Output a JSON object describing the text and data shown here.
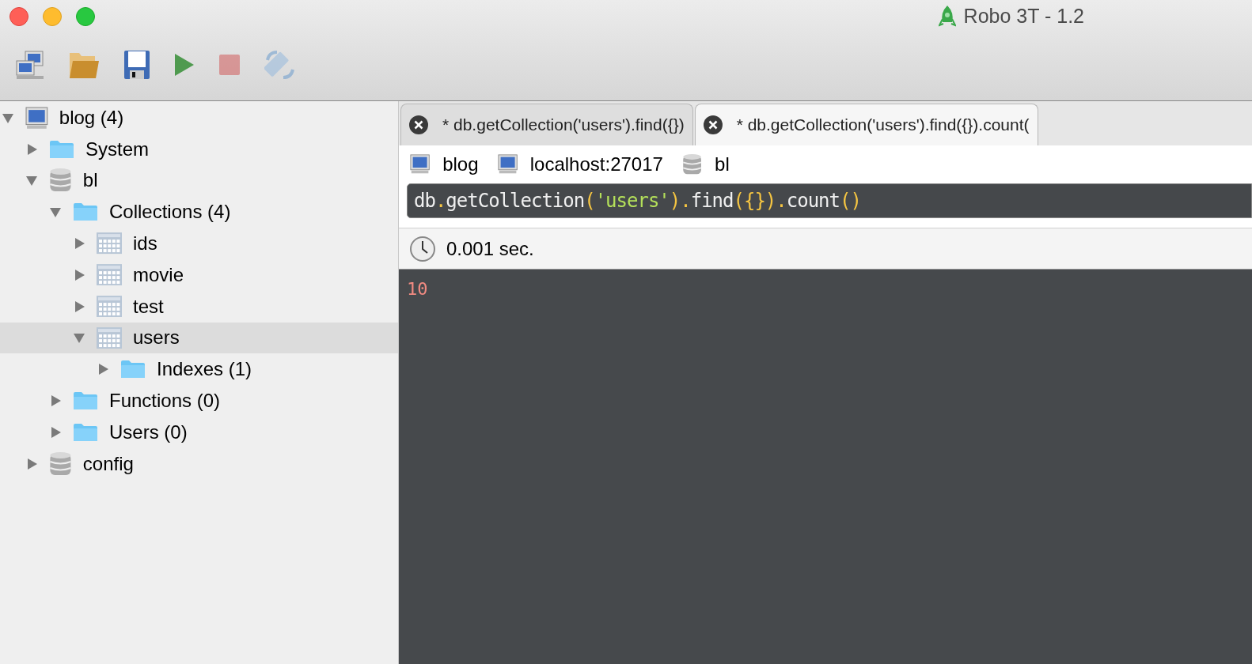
{
  "window": {
    "title": "Robo 3T - 1.2"
  },
  "toolbar": [
    {
      "kind": "connect",
      "disabled": false
    },
    {
      "kind": "open",
      "disabled": false
    },
    {
      "kind": "save",
      "disabled": false
    },
    {
      "kind": "run",
      "disabled": false
    },
    {
      "kind": "stop",
      "disabled": true
    },
    {
      "kind": "rotate",
      "disabled": true
    }
  ],
  "tree": [
    {
      "label": "blog (4)",
      "kind": "server",
      "expanded": true,
      "selected": false,
      "children": [
        {
          "label": "System",
          "kind": "folder",
          "expanded": false,
          "selected": false
        },
        {
          "label": "bl",
          "kind": "database",
          "expanded": true,
          "selected": false,
          "children": [
            {
              "label": "Collections (4)",
              "kind": "folder",
              "expanded": true,
              "selected": false,
              "children": [
                {
                  "label": "ids",
                  "kind": "collection",
                  "expanded": false,
                  "selected": false
                },
                {
                  "label": "movie",
                  "kind": "collection",
                  "expanded": false,
                  "selected": false
                },
                {
                  "label": "test",
                  "kind": "collection",
                  "expanded": false,
                  "selected": false
                },
                {
                  "label": "users",
                  "kind": "collection",
                  "expanded": true,
                  "selected": true,
                  "children": [
                    {
                      "label": "Indexes (1)",
                      "kind": "folder",
                      "expanded": false,
                      "selected": false
                    }
                  ]
                }
              ]
            },
            {
              "label": "Functions (0)",
              "kind": "folder",
              "expanded": false,
              "selected": false
            },
            {
              "label": "Users (0)",
              "kind": "folder",
              "expanded": false,
              "selected": false
            }
          ]
        },
        {
          "label": "config",
          "kind": "database",
          "expanded": false,
          "selected": false
        }
      ]
    }
  ],
  "tabs": [
    {
      "label": "* db.getCollection('users').find({})",
      "selected": false
    },
    {
      "label": "* db.getCollection('users').find({}).count(",
      "selected": true
    }
  ],
  "connection": [
    {
      "kind": "server",
      "label": "blog"
    },
    {
      "kind": "host",
      "label": "localhost:27017"
    },
    {
      "kind": "database",
      "label": "bl"
    }
  ],
  "query": [
    {
      "kind": "plain",
      "text": "db"
    },
    {
      "kind": "punct",
      "text": "."
    },
    {
      "kind": "plain",
      "text": "getCollection"
    },
    {
      "kind": "bracket",
      "text": "("
    },
    {
      "kind": "string",
      "text": "'users'"
    },
    {
      "kind": "bracket",
      "text": ")"
    },
    {
      "kind": "punct",
      "text": "."
    },
    {
      "kind": "plain",
      "text": "find"
    },
    {
      "kind": "bracket",
      "text": "({})"
    },
    {
      "kind": "punct",
      "text": "."
    },
    {
      "kind": "plain",
      "text": "count"
    },
    {
      "kind": "bracket",
      "text": "()"
    }
  ],
  "result": {
    "time": "0.001 sec.",
    "output": "10"
  }
}
